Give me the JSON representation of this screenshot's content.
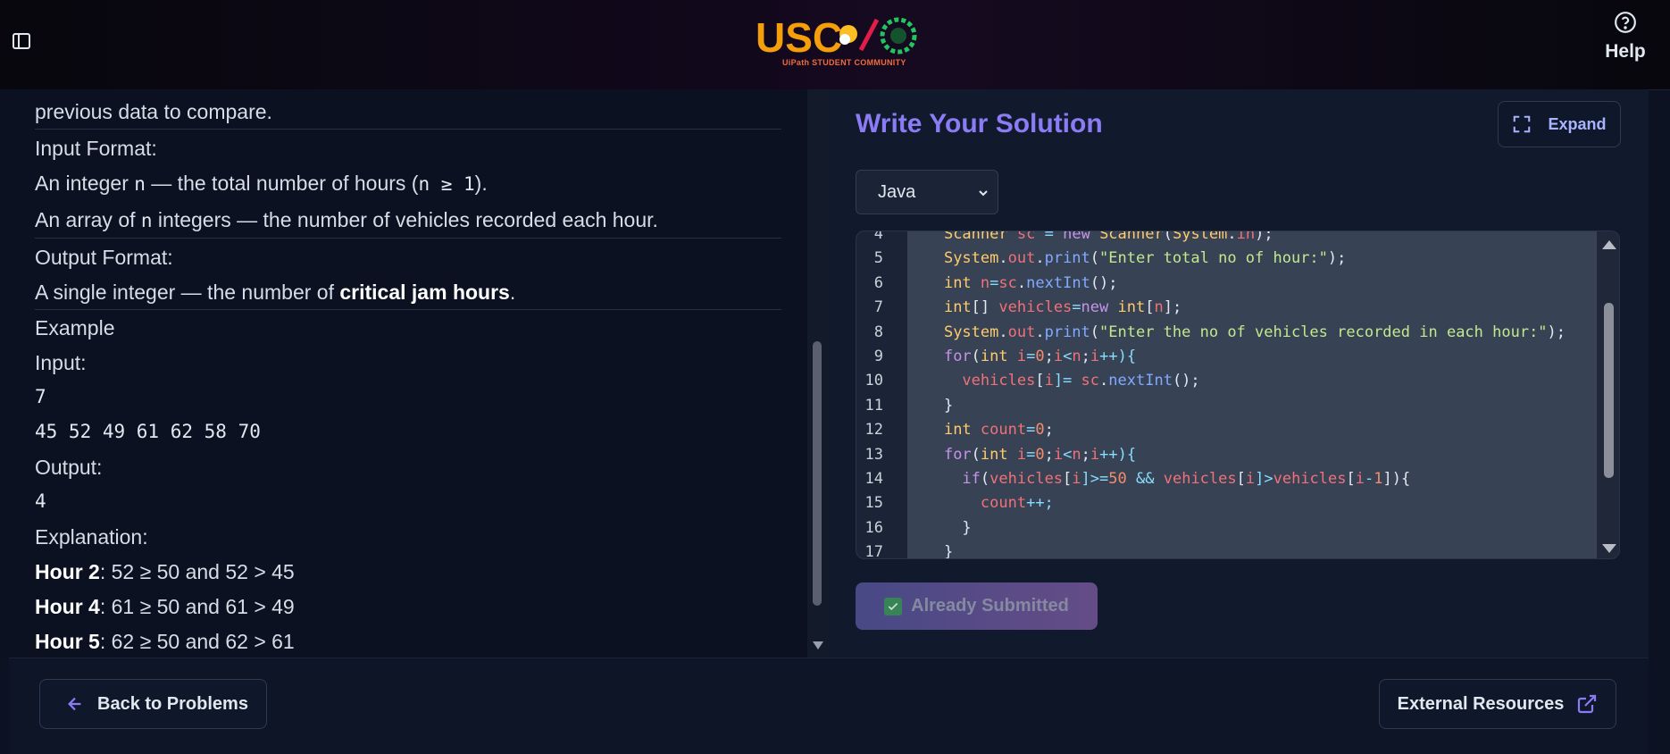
{
  "header": {
    "logo_text": "USC",
    "logo_tagline": "UiPath STUDENT COMMUNITY",
    "help_label": "Help"
  },
  "problem": {
    "line_prev": "previous data to compare.",
    "input_format_heading": "Input Format:",
    "input_line1_a": "An integer ",
    "input_line1_n": "n",
    "input_line1_b": " — the total number of hours (",
    "input_line1_cond": "n ≥ 1",
    "input_line1_c": ").",
    "input_line2_a": "An array of ",
    "input_line2_n": "n",
    "input_line2_b": " integers — the number of vehicles recorded each hour.",
    "output_format_heading": "Output Format:",
    "output_line_a": "A single integer — the number of ",
    "output_line_bold": "critical jam hours",
    "output_line_b": ".",
    "example_heading": "Example",
    "input_label": "Input:",
    "input_value1": "7",
    "input_value2": "45 52 49 61 62 58 70",
    "output_label": "Output:",
    "output_value": "4",
    "explanation_label": "Explanation:",
    "explanations": [
      {
        "bold": "Hour 2",
        "text": ": 52 ≥ 50 and 52 > 45"
      },
      {
        "bold": "Hour 4",
        "text": ": 61 ≥ 50 and 61 > 49"
      },
      {
        "bold": "Hour 5",
        "text": ": 62 ≥ 50 and 62 > 61"
      }
    ]
  },
  "solution": {
    "title": "Write Your Solution",
    "expand_label": "Expand",
    "language": "Java",
    "line_numbers": [
      "4",
      "5",
      "6",
      "7",
      "8",
      "9",
      "10",
      "11",
      "12",
      "13",
      "14",
      "15",
      "16",
      "17"
    ],
    "code_lines": [
      "    Scanner sc = new Scanner(System.in);",
      "    System.out.print(\"Enter total no of hour:\");",
      "    int n=sc.nextInt();",
      "    int[] vehicles=new int[n];",
      "    System.out.print(\"Enter the no of vehicles recorded in each hour:\");",
      "    for(int i=0;i<n;i++){",
      "      vehicles[i]= sc.nextInt();",
      "    }",
      "    int count=0;",
      "    for(int i=0;i<n;i++){",
      "      if(vehicles[i]>=50 && vehicles[i]>vehicles[i-1]){",
      "        count++;",
      "      }",
      "    }"
    ],
    "submit_label": "Already Submitted"
  },
  "footer": {
    "back_label": "Back to Problems",
    "external_label": "External Resources"
  },
  "colors": {
    "accent": "#8b7cf6",
    "background": "#0c1222"
  }
}
